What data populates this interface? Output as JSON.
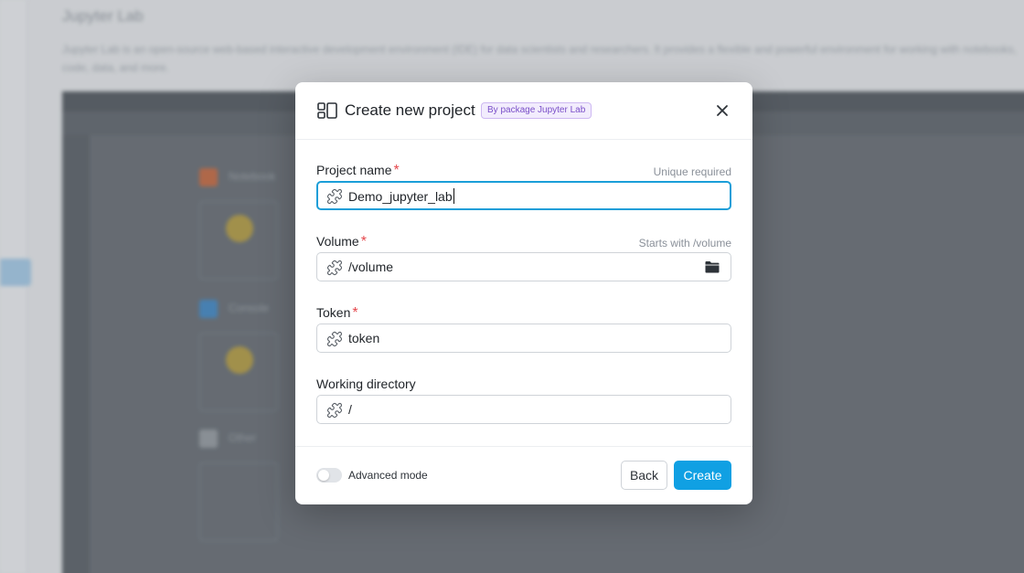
{
  "background": {
    "page_title": "Jupyter Lab",
    "description": "Jupyter Lab is an open-source web-based interactive development environment (IDE) for data scientists and researchers. It provides a flexible and powerful environment for working with notebooks, code, data, and more.",
    "sections": [
      "Notebook",
      "Console",
      "Other"
    ]
  },
  "dialog": {
    "title": "Create new project",
    "badge": "By package Jupyter Lab",
    "fields": {
      "project_name": {
        "label": "Project name",
        "required_mark": "*",
        "hint": "Unique required",
        "value": "Demo_jupyter_lab"
      },
      "volume": {
        "label": "Volume",
        "required_mark": "*",
        "hint": "Starts with /volume",
        "value": "/volume"
      },
      "token": {
        "label": "Token",
        "required_mark": "*",
        "value": "token"
      },
      "working_directory": {
        "label": "Working directory",
        "value": "/"
      }
    },
    "footer": {
      "advanced_mode_label": "Advanced mode",
      "advanced_mode_on": false,
      "back_label": "Back",
      "create_label": "Create"
    }
  },
  "colors": {
    "accent": "#10a0e3",
    "focus_border": "#1a9ed8",
    "required": "#e5484d",
    "badge_text": "#7a4fc8",
    "badge_bg": "#f2ecfd"
  },
  "icons": {
    "header": "project-layout-icon",
    "field": "puzzle-icon",
    "close": "close-icon",
    "browse": "folder-icon"
  }
}
